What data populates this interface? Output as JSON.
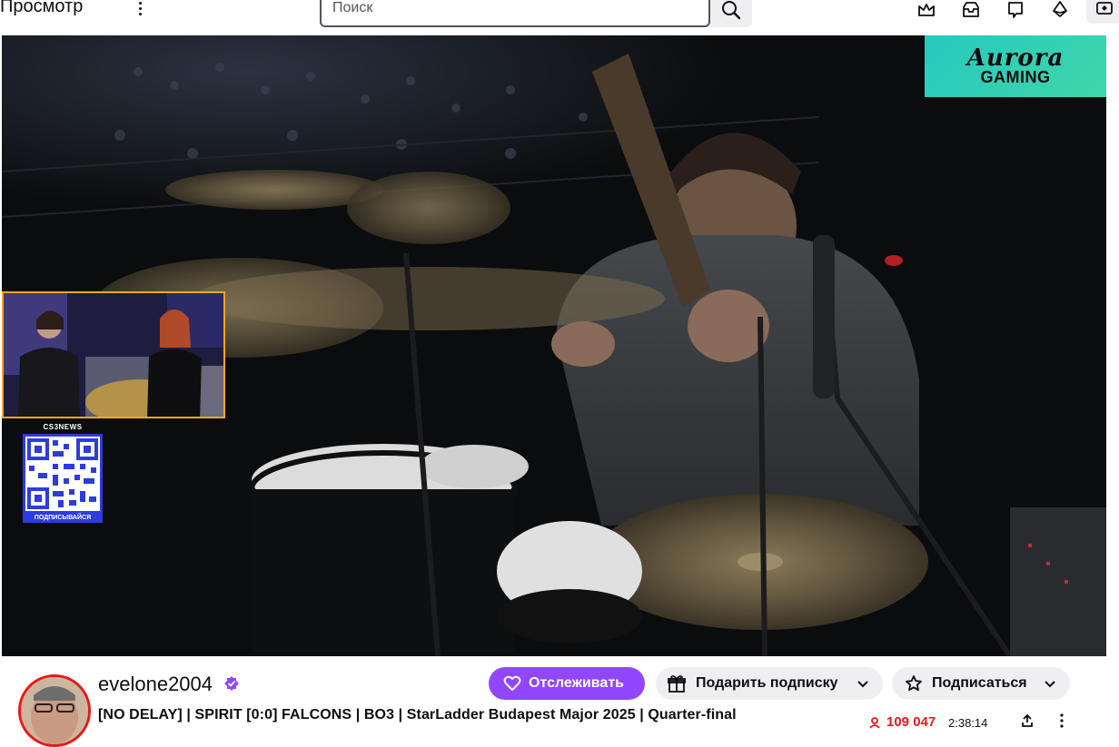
{
  "topbar": {
    "browse_label": "Просмотр",
    "more_icon": "more-vertical-icon",
    "search": {
      "placeholder": "Поиск",
      "value": ""
    },
    "search_icon": "search-icon",
    "icons": [
      "crown-icon",
      "inbox-icon",
      "chat-bubble-icon",
      "bits-icon",
      "prime-loot-icon"
    ]
  },
  "player": {
    "sponsor": {
      "script": "Aurora",
      "word": "GAMING"
    },
    "overlay": {
      "qr_title": "CS3NEWS",
      "qr_caption": "ПОДПИСЫВАЙСЯ"
    }
  },
  "channel": {
    "name": "evelone2004",
    "verified_icon": "verified-badge-icon",
    "title": "[NO DELAY] | SPIRIT [0:0] FALCONS | BO3 | StarLadder Budapest Major 2025 | Quarter-final",
    "follow_label": "Отслеживать",
    "gift_label": "Подарить подписку",
    "subscribe_label": "Подписаться",
    "viewers": "109 047",
    "uptime": "2:38:14"
  },
  "colors": {
    "accent": "#9147ff",
    "live_red": "#e91916",
    "sponsor_teal": "#27c9c1",
    "qr_blue": "#2d3be0",
    "cam_border": "#f2a81e"
  }
}
